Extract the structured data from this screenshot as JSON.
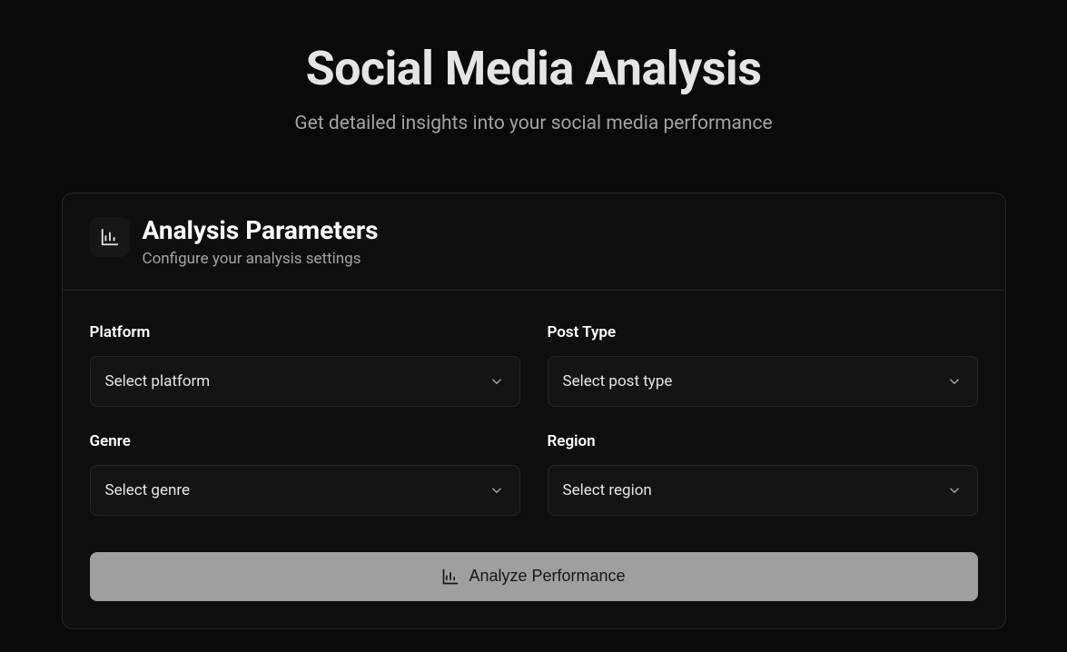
{
  "header": {
    "title": "Social Media Analysis",
    "subtitle": "Get detailed insights into your social media performance"
  },
  "card": {
    "title": "Analysis Parameters",
    "subtitle": "Configure your analysis settings"
  },
  "fields": {
    "platform": {
      "label": "Platform",
      "placeholder": "Select platform"
    },
    "post_type": {
      "label": "Post Type",
      "placeholder": "Select post type"
    },
    "genre": {
      "label": "Genre",
      "placeholder": "Select genre"
    },
    "region": {
      "label": "Region",
      "placeholder": "Select region"
    }
  },
  "buttons": {
    "analyze": "Analyze Performance"
  }
}
